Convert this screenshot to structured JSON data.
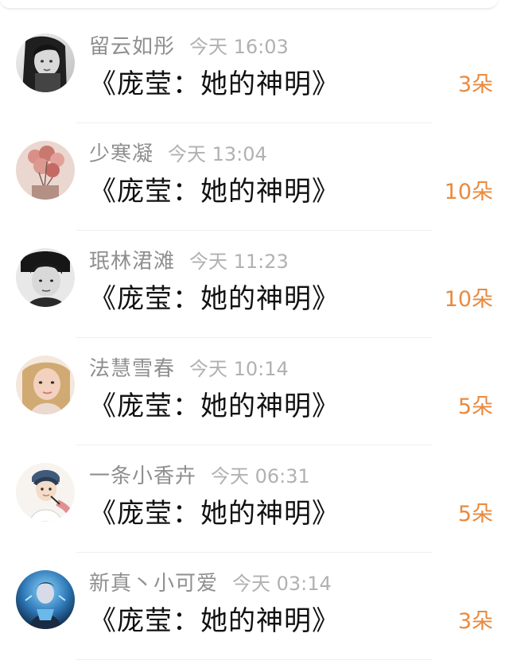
{
  "colors": {
    "accent": "#e98a3f",
    "username": "#8f8f8f",
    "time": "#b1b1b1",
    "title": "#111111",
    "divider": "#efefef"
  },
  "items": [
    {
      "username": "留云如彤",
      "time": "今天 16:03",
      "title": "《庞莹：她的神明》",
      "count": "3朵",
      "avatar_icon": "grayscale-portrait-avatar"
    },
    {
      "username": "少寒凝",
      "time": "今天 13:04",
      "title": "《庞莹：她的神明》",
      "count": "10朵",
      "avatar_icon": "pink-balloons-avatar"
    },
    {
      "username": "珉林涒滩",
      "time": "今天 11:23",
      "title": "《庞莹：她的神明》",
      "count": "10朵",
      "avatar_icon": "black-white-child-avatar"
    },
    {
      "username": "法慧雪春",
      "time": "今天 10:14",
      "title": "《庞莹：她的神明》",
      "count": "5朵",
      "avatar_icon": "blonde-girl-avatar"
    },
    {
      "username": "一条小香卉",
      "time": "今天 06:31",
      "title": "《庞莹：她的神明》",
      "count": "5朵",
      "avatar_icon": "anime-illustration-avatar"
    },
    {
      "username": "新真丶小可爱",
      "time": "今天 03:14",
      "title": "《庞莹：她的神明》",
      "count": "3朵",
      "avatar_icon": "blue-performer-avatar"
    }
  ]
}
